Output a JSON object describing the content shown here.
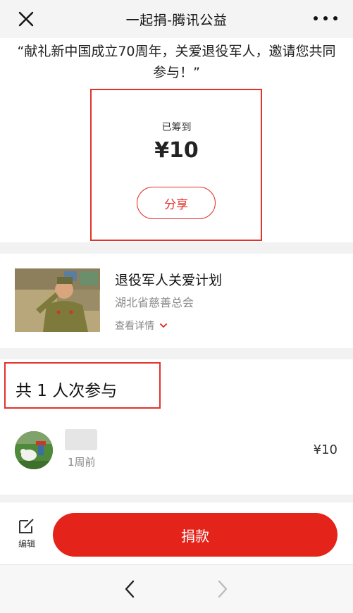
{
  "topbar": {
    "title": "一起捐-腾讯公益",
    "close_icon": "close-icon",
    "more_icon": "more-icon"
  },
  "quote": "“献礼新中国成立70周年，关爱退役军人，邀请您共同参与！”",
  "raised": {
    "label": "已筹到",
    "amount": "¥10",
    "share_label": "分享"
  },
  "project": {
    "title": "退役军人关爱计划",
    "org": "湖北省慈善总会",
    "detail_label": "查看详情"
  },
  "participants": {
    "title": "共 1 人次参与",
    "donors": [
      {
        "time": "1周前",
        "amount": "¥10"
      }
    ]
  },
  "bottom": {
    "edit_label": "编辑",
    "donate_label": "捐款"
  },
  "colors": {
    "accent": "#e4231b",
    "highlight_box": "#e4312b"
  }
}
